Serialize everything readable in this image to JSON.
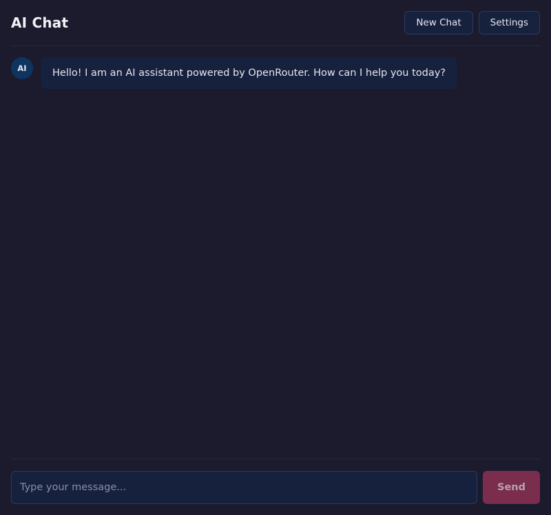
{
  "header": {
    "title": "AI Chat",
    "new_chat_label": "New Chat",
    "settings_label": "Settings"
  },
  "messages": [
    {
      "role": "assistant",
      "avatar_text": "AI",
      "text": "Hello! I am an AI assistant powered by OpenRouter. How can I help you today?"
    }
  ],
  "composer": {
    "placeholder": "Type your message...",
    "value": "",
    "send_label": "Send",
    "send_disabled": true
  },
  "colors": {
    "background": "#1b1b2d",
    "surface": "#16213e",
    "accent": "#0f3460",
    "send_button": "#7a2d4d"
  }
}
